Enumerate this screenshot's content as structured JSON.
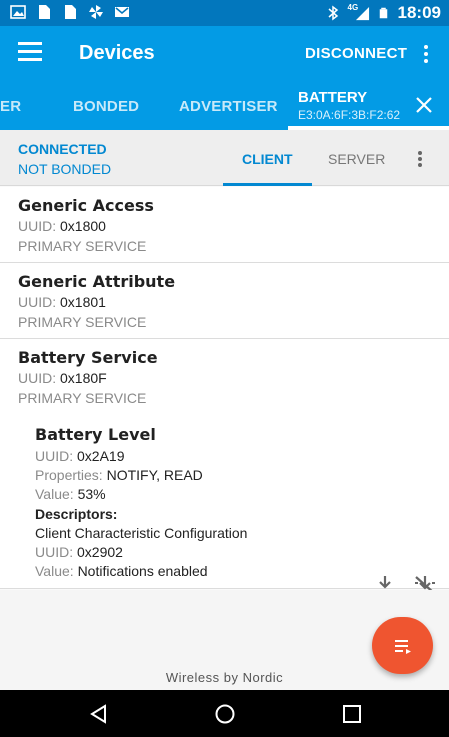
{
  "status_bar": {
    "time": "18:09",
    "network": "4G",
    "icons": [
      "image-icon",
      "document-icon",
      "document-icon",
      "pinwheel-icon",
      "mail-icon",
      "bluetooth-icon",
      "signal-icon",
      "battery-icon"
    ]
  },
  "app_bar": {
    "title": "Devices",
    "disconnect_label": "DISCONNECT"
  },
  "tabs": {
    "items": [
      {
        "label": "ER"
      },
      {
        "label": "BONDED"
      },
      {
        "label": "ADVERTISER"
      }
    ],
    "active": {
      "label": "BATTERY",
      "address": "E3:0A:6F:3B:F2:62"
    }
  },
  "connection": {
    "status": "CONNECTED",
    "bond": "NOT BONDED",
    "client_tab": "CLIENT",
    "server_tab": "SERVER"
  },
  "services": [
    {
      "name": "Generic Access",
      "uuid_label": "UUID:",
      "uuid": "0x1800",
      "type": "PRIMARY SERVICE"
    },
    {
      "name": "Generic Attribute",
      "uuid_label": "UUID:",
      "uuid": "0x1801",
      "type": "PRIMARY SERVICE"
    },
    {
      "name": "Battery Service",
      "uuid_label": "UUID:",
      "uuid": "0x180F",
      "type": "PRIMARY SERVICE"
    }
  ],
  "characteristic": {
    "name": "Battery Level",
    "uuid_label": "UUID:",
    "uuid": "0x2A19",
    "properties_label": "Properties:",
    "properties": "NOTIFY, READ",
    "value_label": "Value:",
    "value": "53%",
    "descriptors_label": "Descriptors:",
    "descriptor": {
      "name": "Client Characteristic Configuration",
      "uuid_label": "UUID:",
      "uuid": "0x2902",
      "value_label": "Value:",
      "value": "Notifications enabled"
    }
  },
  "footer": {
    "text": "Wireless by Nordic"
  },
  "colors": {
    "status_bar": "#0277bd",
    "app_bar": "#039be5",
    "accent": "#0288d1",
    "fab": "#ef5530"
  }
}
